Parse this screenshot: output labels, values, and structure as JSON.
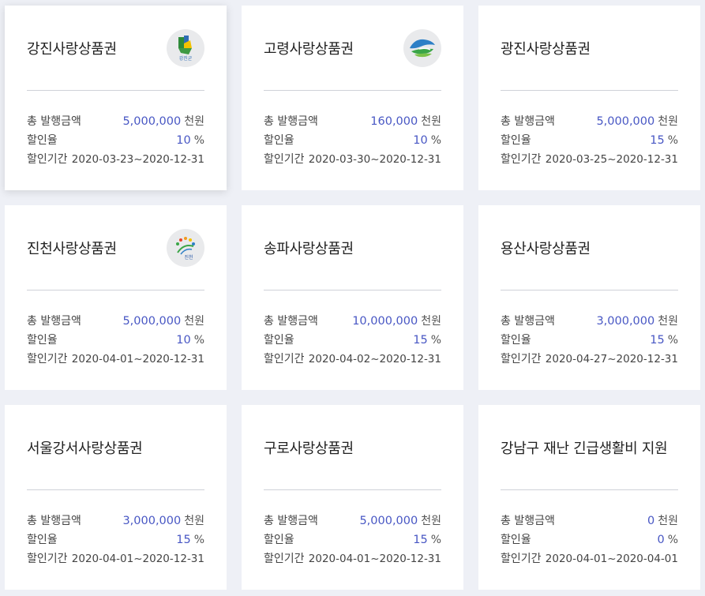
{
  "labels": {
    "total": "총 발행금액",
    "rate": "할인율",
    "period": "할인기간",
    "unit_amount": "천원",
    "unit_rate": "%"
  },
  "cards": [
    {
      "title": "강진사랑상품권",
      "amount": "5,000,000",
      "rate": "10",
      "period": "2020-03-23~2020-12-31",
      "logo": "gangjin-county-logo",
      "logo_text": "강진군"
    },
    {
      "title": "고령사랑상품권",
      "amount": "160,000",
      "rate": "10",
      "period": "2020-03-30~2020-12-31",
      "logo": "goryeong-county-logo"
    },
    {
      "title": "광진사랑상품권",
      "amount": "5,000,000",
      "rate": "15",
      "period": "2020-03-25~2020-12-31"
    },
    {
      "title": "진천사랑상품권",
      "amount": "5,000,000",
      "rate": "10",
      "period": "2020-04-01~2020-12-31",
      "logo": "jincheon-county-logo",
      "logo_text": "진천"
    },
    {
      "title": "송파사랑상품권",
      "amount": "10,000,000",
      "rate": "15",
      "period": "2020-04-02~2020-12-31"
    },
    {
      "title": "용산사랑상품권",
      "amount": "3,000,000",
      "rate": "15",
      "period": "2020-04-27~2020-12-31"
    },
    {
      "title": "서울강서사랑상품권",
      "amount": "3,000,000",
      "rate": "15",
      "period": "2020-04-01~2020-12-31"
    },
    {
      "title": "구로사랑상품권",
      "amount": "5,000,000",
      "rate": "15",
      "period": "2020-04-01~2020-12-31"
    },
    {
      "title": "강남구 재난 긴급생활비 지원",
      "amount": "0",
      "rate": "0",
      "period": "2020-04-01~2020-04-01"
    }
  ],
  "colors": {
    "accent": "#4857c4",
    "background": "#eef0f6",
    "card": "#ffffff"
  }
}
